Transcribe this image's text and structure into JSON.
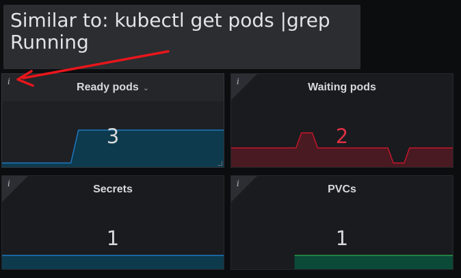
{
  "tooltip": {
    "line1": "Similar to: kubectl get pods |grep",
    "line2": "Running"
  },
  "panels": [
    {
      "title": "Ready pods",
      "value": "3",
      "value_color": "#d8d9da",
      "series_color": "#1f78c1",
      "fill_color": "#0d3a4d",
      "sparkline": [
        1,
        1,
        1,
        1,
        1,
        1,
        1,
        1,
        1,
        1,
        3,
        3,
        3,
        3,
        3,
        3,
        3,
        3,
        3,
        3,
        3,
        3,
        3,
        3,
        3,
        3,
        3,
        3,
        3,
        3
      ]
    },
    {
      "title": "Waiting pods",
      "value": "2",
      "value_color": "#e02f44",
      "series_color": "#c4162a",
      "fill_color": "#4a1a22",
      "sparkline": [
        2,
        2,
        2,
        2,
        2,
        2,
        2,
        2,
        2,
        2,
        2,
        2,
        2,
        3,
        3,
        3,
        2,
        2,
        2,
        2,
        2,
        2,
        2,
        2,
        2,
        2,
        2,
        2,
        2,
        2,
        1,
        1,
        1,
        2,
        2,
        2,
        2,
        2,
        2,
        2,
        2,
        2
      ]
    },
    {
      "title": "Secrets",
      "value": "1",
      "value_color": "#d8d9da",
      "series_color": "#1f78c1",
      "fill_color": "#0d3a4d",
      "sparkline": [
        1,
        1,
        1,
        1,
        1,
        1,
        1,
        1,
        1,
        1
      ]
    },
    {
      "title": "PVCs",
      "value": "1",
      "value_color": "#d8d9da",
      "series_color": "#299c46",
      "fill_color": "#0b4a36",
      "sparkline": [
        null,
        null,
        null,
        null,
        1,
        1,
        1,
        1,
        1,
        1,
        1,
        1,
        1,
        1,
        1
      ]
    }
  ]
}
